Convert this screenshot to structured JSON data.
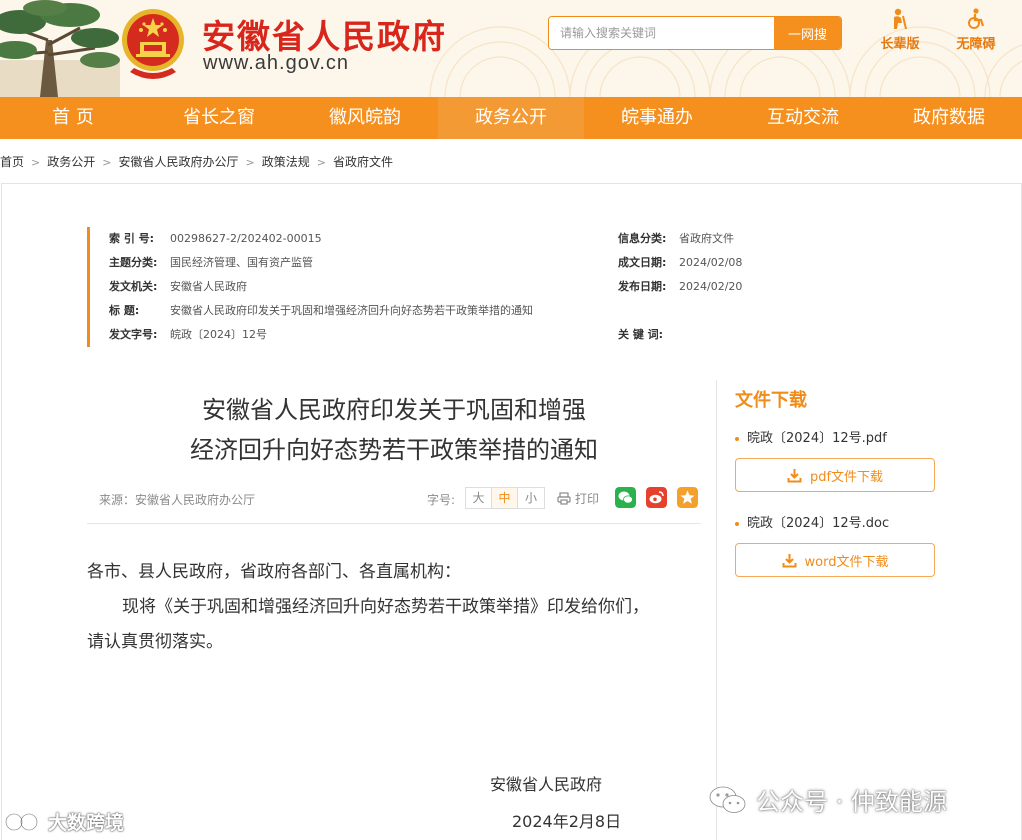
{
  "header": {
    "site_title": "安徽省人民政府",
    "site_domain": "www.ah.gov.cn",
    "search_placeholder": "请输入搜索关键词",
    "search_button": "一网搜",
    "elder_mode": "长辈版",
    "accessibility": "无障碍"
  },
  "nav": {
    "items": [
      "首  页",
      "省长之窗",
      "徽风皖韵",
      "政务公开",
      "皖事通办",
      "互动交流",
      "政府数据"
    ],
    "active": "政务公开"
  },
  "breadcrumb": [
    "首页",
    "政务公开",
    "安徽省人民政府办公厅",
    "政策法规",
    "省政府文件"
  ],
  "meta": {
    "index_no_label": "索  引  号:",
    "index_no": "00298627-2/202402-00015",
    "category_label": "信息分类:",
    "category": "省政府文件",
    "topic_label": "主题分类:",
    "topic": "国民经济管理、国有资产监管",
    "created_label": "成文日期:",
    "created": "2024/02/08",
    "issuer_label": "发文机关:",
    "issuer": "安徽省人民政府",
    "published_label": "发布日期:",
    "published": "2024/02/20",
    "title_label": "标      题:",
    "title": "安徽省人民政府印发关于巩固和增强经济回升向好态势若干政策举措的通知",
    "doc_no_label": "发文字号:",
    "doc_no": "皖政〔2024〕12号",
    "keywords_label": "关  键  词:",
    "keywords": ""
  },
  "article": {
    "title_line1": "安徽省人民政府印发关于巩固和增强",
    "title_line2": "经济回升向好态势若干政策举措的通知",
    "source": "来源：安徽省人民政府办公厅",
    "font_size_label": "字号:",
    "font_sizes": [
      "大",
      "中",
      "小"
    ],
    "font_size_selected": "中",
    "print_label": "打印",
    "salutation": "各市、县人民政府，省政府各部门、各直属机构：",
    "para1": "现将《关于巩固和增强经济回升向好态势若干政策举措》印发给你们，",
    "para2": "请认真贯彻落实。",
    "sign_org": "安徽省人民政府",
    "sign_date": "2024年2月8日"
  },
  "downloads": {
    "title": "文件下载",
    "files": [
      {
        "name": "晥政〔2024〕12号.pdf",
        "button": "pdf文件下载"
      },
      {
        "name": "晥政〔2024〕12号.doc",
        "button": "word文件下载"
      }
    ]
  },
  "watermarks": {
    "left": "大数跨境",
    "right": "公众号 · 仲致能源"
  },
  "colors": {
    "brand_orange": "#f5901e",
    "title_red": "#d9261c",
    "accent": "#f08c1a"
  }
}
